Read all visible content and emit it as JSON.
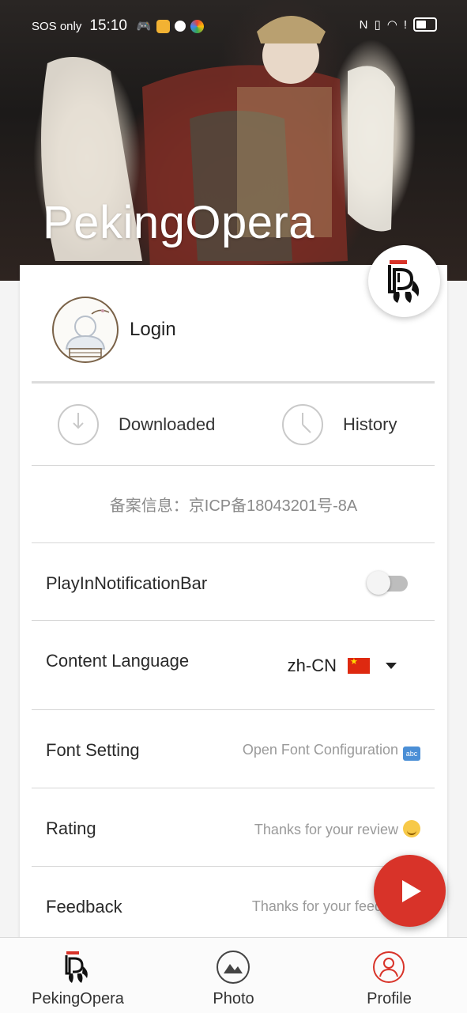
{
  "status_bar": {
    "carrier": "SOS only",
    "time": "15:10",
    "nfc": "N"
  },
  "hero": {
    "title": "PekingOpera"
  },
  "login": {
    "label": "Login"
  },
  "quick_actions": {
    "downloaded_label": "Downloaded",
    "history_label": "History"
  },
  "icp_text": "备案信息：京ICP备18043201号-8A",
  "settings": {
    "notification_bar": {
      "label": "PlayInNotificationBar",
      "enabled": false
    },
    "content_language": {
      "label": "Content Language",
      "value": "zh-CN"
    },
    "font_setting": {
      "label": "Font Setting",
      "hint": "Open Font Configuration"
    },
    "rating": {
      "label": "Rating",
      "hint": "Thanks for your review"
    },
    "feedback": {
      "label": "Feedback",
      "hint": "Thanks for your feedb"
    }
  },
  "bottom_nav": {
    "items": [
      {
        "label": "PekingOpera",
        "icon": "opera-mask-icon"
      },
      {
        "label": "Photo",
        "icon": "photo-icon"
      },
      {
        "label": "Profile",
        "icon": "profile-icon"
      }
    ]
  },
  "colors": {
    "accent": "#d83329",
    "text": "#222222",
    "hint": "#9a9a9a",
    "divider": "#d6d6d6"
  }
}
